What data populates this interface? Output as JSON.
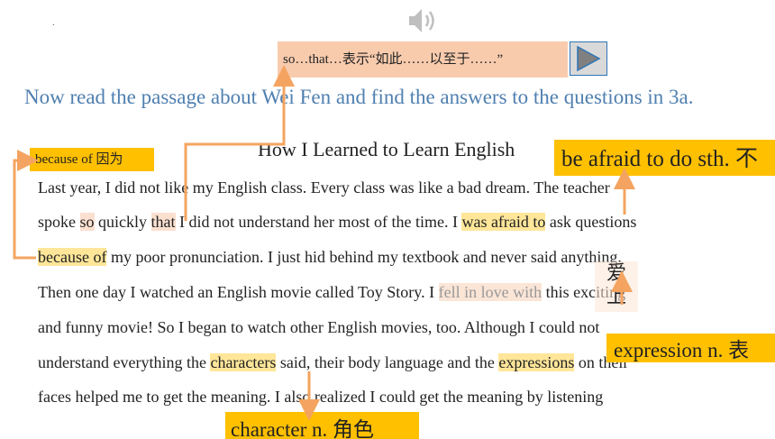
{
  "header": {
    "dot": ".",
    "note_so_that": "so…that…表示“如此……以至于……”"
  },
  "instruction": "Now read the passage about Wei Fen and find the answers to the questions in 3a.",
  "passage": {
    "title": "How I Learned to Learn English",
    "lines": {
      "l1": "Last year, I did not like my English class. Every class was like a bad dream. The teacher",
      "l2a": "spoke ",
      "l2_so": "so",
      "l2b": " quickly ",
      "l2_that": "that",
      "l2c": " I did not understand her most of the time. I ",
      "l2_afraid": "was afraid to",
      "l2d": " ask questions",
      "l3_because": "because of",
      "l3b": " my poor pronunciation. I just hid behind my textbook and never said anything.",
      "l4a": "Then one day I watched an English movie called Toy Story. I ",
      "l4_fell": "fell in love with",
      "l4b": " this exciting",
      "l5": "and funny movie! So I began to watch other English movies, too. Although I could not",
      "l6a": "understand everything the ",
      "l6_characters": "characters",
      "l6b": " said, their body language and the ",
      "l6_expressions": "expressions",
      "l6c": " on their",
      "l7": "faces helped me to get the meaning. I also realized I could get the meaning by listening"
    }
  },
  "notes": {
    "because_of": "because of 因为",
    "be_afraid": "be afraid to do sth. 不",
    "ai_shang_1": "爱",
    "ai_shang_2": "上",
    "expression": "expression n. 表",
    "character": "character n. 角色"
  },
  "colors": {
    "arrow": "#f4a460",
    "note_yellow": "#ffc000",
    "note_pink": "#f8cbad",
    "instruction_blue": "#4f7fb0"
  },
  "icons": [
    "speaker-icon",
    "play-icon"
  ]
}
